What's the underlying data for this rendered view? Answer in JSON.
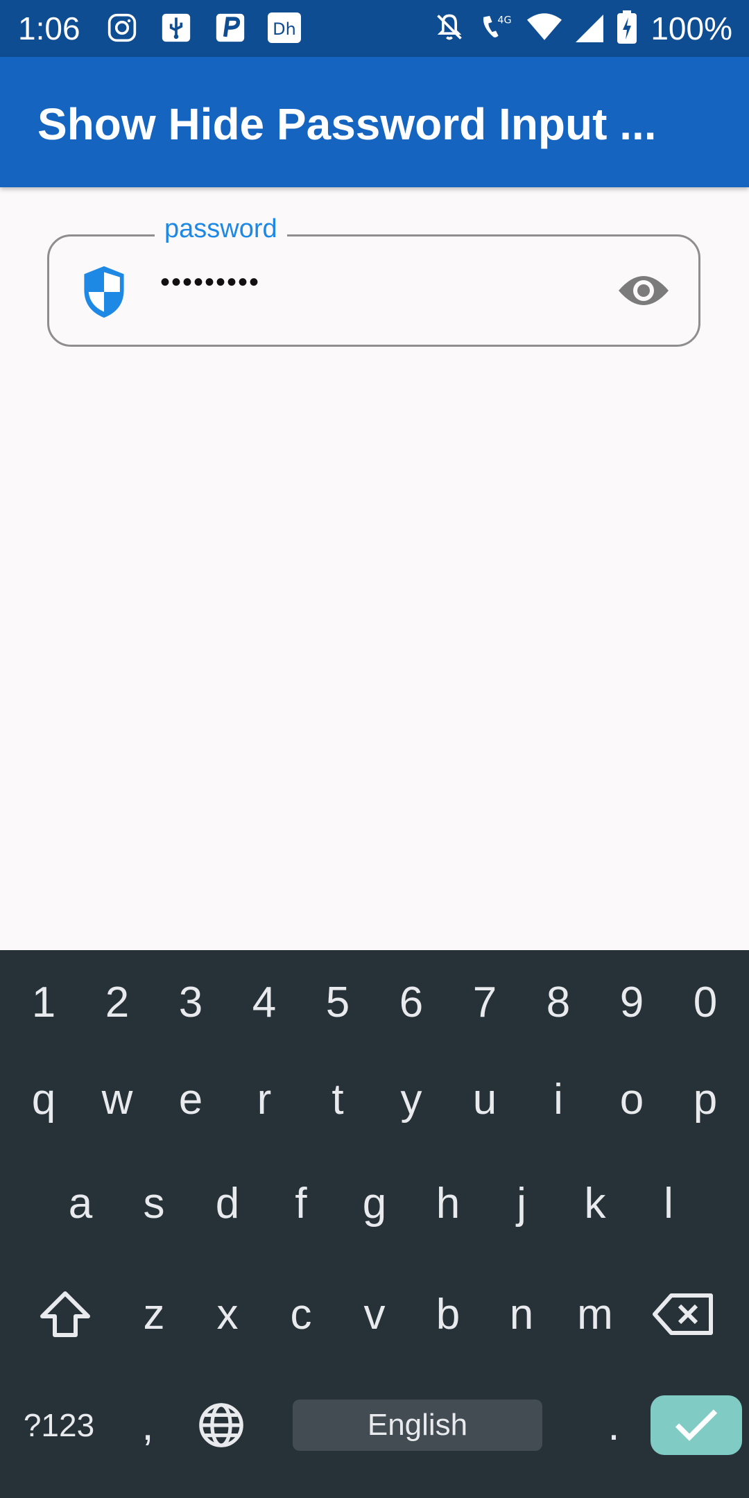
{
  "status_bar": {
    "time": "1:06",
    "battery": "100%",
    "network": "4G",
    "icons": [
      "instagram-icon",
      "usb-icon",
      "p-icon",
      "dh-icon",
      "mute-icon",
      "call-4g-icon",
      "wifi-icon",
      "signal-icon",
      "battery-charging-icon"
    ]
  },
  "appbar": {
    "title": "Show Hide Password Input ..."
  },
  "password_field": {
    "label": "password",
    "value": "•••••••••",
    "leading_icon": "shield-icon",
    "trailing_icon": "eye-icon"
  },
  "keyboard": {
    "row_numbers": [
      "1",
      "2",
      "3",
      "4",
      "5",
      "6",
      "7",
      "8",
      "9",
      "0"
    ],
    "row_q": [
      "q",
      "w",
      "e",
      "r",
      "t",
      "y",
      "u",
      "i",
      "o",
      "p"
    ],
    "row_a": [
      "a",
      "s",
      "d",
      "f",
      "g",
      "h",
      "j",
      "k",
      "l"
    ],
    "row_z": [
      "z",
      "x",
      "c",
      "v",
      "b",
      "n",
      "m"
    ],
    "symbols_key": "?123",
    "comma_key": ",",
    "space_label": "English",
    "period_key": "."
  },
  "colors": {
    "status_bar": "#0f4d92",
    "appbar": "#1565c0",
    "accent": "#1e88e5",
    "keyboard_bg": "#263238",
    "enter_key": "#80cbc4"
  }
}
